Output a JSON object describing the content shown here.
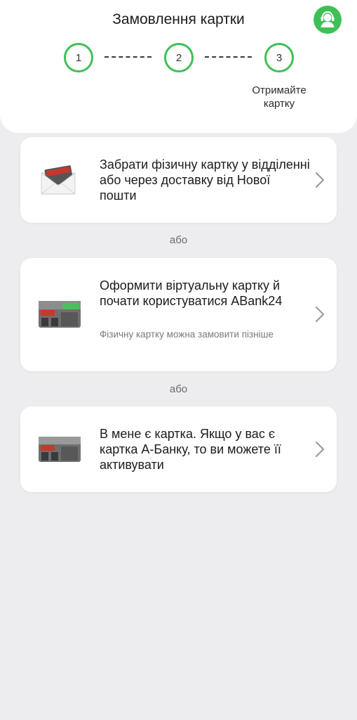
{
  "header": {
    "title": "Замовлення картки",
    "support_icon": "headset-user-icon",
    "steps": [
      {
        "number": "1"
      },
      {
        "number": "2"
      },
      {
        "number": "3",
        "caption": "Отримайте картку"
      }
    ]
  },
  "options": [
    {
      "title": "Забрати фізичну картку у відділенні або через доставку від Нової пошти",
      "icon": "envelope-card-icon"
    },
    {
      "title": "Оформити віртуальну картку й почати користуватися ABank24",
      "subtitle": "Фізичну картку можна замовити пізніше",
      "icon": "bank-branch-icon"
    },
    {
      "title": "В мене є картка. Якщо у вас є картка А-Банку, то ви можете її активувати",
      "icon": "bank-branch-icon"
    }
  ],
  "separator_text": "або",
  "colors": {
    "accent": "#3fc056",
    "background": "#ededef",
    "card": "#ffffff"
  }
}
